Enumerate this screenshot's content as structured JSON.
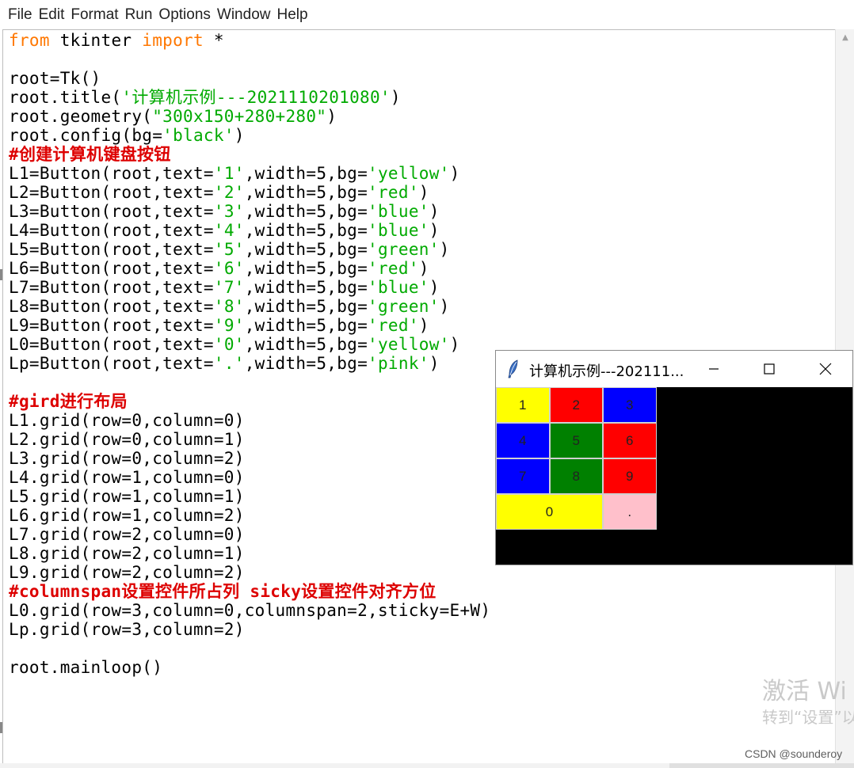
{
  "menu": [
    "File",
    "Edit",
    "Format",
    "Run",
    "Options",
    "Window",
    "Help"
  ],
  "code_lines": [
    [
      {
        "t": "from",
        "c": "kw"
      },
      {
        "t": " tkinter "
      },
      {
        "t": "import",
        "c": "kw"
      },
      {
        "t": " *"
      }
    ],
    [],
    [
      {
        "t": "root=Tk()"
      }
    ],
    [
      {
        "t": "root.title("
      },
      {
        "t": "'计算机示例---2021110201080'",
        "c": "str"
      },
      {
        "t": ")"
      }
    ],
    [
      {
        "t": "root.geometry("
      },
      {
        "t": "\"300x150+280+280\"",
        "c": "str"
      },
      {
        "t": ")"
      }
    ],
    [
      {
        "t": "root.config(bg="
      },
      {
        "t": "'black'",
        "c": "str"
      },
      {
        "t": ")"
      }
    ],
    [
      {
        "t": "#创建计算机键盘按钮",
        "c": "cmt"
      }
    ],
    [
      {
        "t": "L1=Button(root,text="
      },
      {
        "t": "'1'",
        "c": "str"
      },
      {
        "t": ",width=5,bg="
      },
      {
        "t": "'yellow'",
        "c": "str"
      },
      {
        "t": ")"
      }
    ],
    [
      {
        "t": "L2=Button(root,text="
      },
      {
        "t": "'2'",
        "c": "str"
      },
      {
        "t": ",width=5,bg="
      },
      {
        "t": "'red'",
        "c": "str"
      },
      {
        "t": ")"
      }
    ],
    [
      {
        "t": "L3=Button(root,text="
      },
      {
        "t": "'3'",
        "c": "str"
      },
      {
        "t": ",width=5,bg="
      },
      {
        "t": "'blue'",
        "c": "str"
      },
      {
        "t": ")"
      }
    ],
    [
      {
        "t": "L4=Button(root,text="
      },
      {
        "t": "'4'",
        "c": "str"
      },
      {
        "t": ",width=5,bg="
      },
      {
        "t": "'blue'",
        "c": "str"
      },
      {
        "t": ")"
      }
    ],
    [
      {
        "t": "L5=Button(root,text="
      },
      {
        "t": "'5'",
        "c": "str"
      },
      {
        "t": ",width=5,bg="
      },
      {
        "t": "'green'",
        "c": "str"
      },
      {
        "t": ")"
      }
    ],
    [
      {
        "t": "L6=Button(root,text="
      },
      {
        "t": "'6'",
        "c": "str"
      },
      {
        "t": ",width=5,bg="
      },
      {
        "t": "'red'",
        "c": "str"
      },
      {
        "t": ")"
      }
    ],
    [
      {
        "t": "L7=Button(root,text="
      },
      {
        "t": "'7'",
        "c": "str"
      },
      {
        "t": ",width=5,bg="
      },
      {
        "t": "'blue'",
        "c": "str"
      },
      {
        "t": ")"
      }
    ],
    [
      {
        "t": "L8=Button(root,text="
      },
      {
        "t": "'8'",
        "c": "str"
      },
      {
        "t": ",width=5,bg="
      },
      {
        "t": "'green'",
        "c": "str"
      },
      {
        "t": ")"
      }
    ],
    [
      {
        "t": "L9=Button(root,text="
      },
      {
        "t": "'9'",
        "c": "str"
      },
      {
        "t": ",width=5,bg="
      },
      {
        "t": "'red'",
        "c": "str"
      },
      {
        "t": ")"
      }
    ],
    [
      {
        "t": "L0=Button(root,text="
      },
      {
        "t": "'0'",
        "c": "str"
      },
      {
        "t": ",width=5,bg="
      },
      {
        "t": "'yellow'",
        "c": "str"
      },
      {
        "t": ")"
      }
    ],
    [
      {
        "t": "Lp=Button(root,text="
      },
      {
        "t": "'.'",
        "c": "str"
      },
      {
        "t": ",width=5,bg="
      },
      {
        "t": "'pink'",
        "c": "str"
      },
      {
        "t": ")"
      }
    ],
    [],
    [
      {
        "t": "#gird进行布局",
        "c": "cmt"
      }
    ],
    [
      {
        "t": "L1.grid(row=0,column=0)"
      }
    ],
    [
      {
        "t": "L2.grid(row=0,column=1)"
      }
    ],
    [
      {
        "t": "L3.grid(row=0,column=2)"
      }
    ],
    [
      {
        "t": "L4.grid(row=1,column=0)"
      }
    ],
    [
      {
        "t": "L5.grid(row=1,column=1)"
      }
    ],
    [
      {
        "t": "L6.grid(row=1,column=2)"
      }
    ],
    [
      {
        "t": "L7.grid(row=2,column=0)"
      }
    ],
    [
      {
        "t": "L8.grid(row=2,column=1)"
      }
    ],
    [
      {
        "t": "L9.grid(row=2,column=2)"
      }
    ],
    [
      {
        "t": "#columnspan设置控件所占列 sicky设置控件对齐方位",
        "c": "cmt"
      }
    ],
    [
      {
        "t": "L0.grid(row=3,column=0,columnspan=2,sticky=E+W)"
      }
    ],
    [
      {
        "t": "Lp.grid(row=3,column=2)"
      }
    ],
    [],
    [
      {
        "t": "root.mainloop()"
      }
    ]
  ],
  "tk_window": {
    "title": "计算机示例---202111...",
    "minimize_icon": "minimize-icon",
    "maximize_icon": "maximize-icon",
    "close_icon": "close-icon",
    "background": "#000000",
    "buttons": [
      {
        "label": "1",
        "color": "#ffff00",
        "row": 0,
        "col": 0,
        "span": 1
      },
      {
        "label": "2",
        "color": "#ff0000",
        "row": 0,
        "col": 1,
        "span": 1
      },
      {
        "label": "3",
        "color": "#0000ff",
        "row": 0,
        "col": 2,
        "span": 1
      },
      {
        "label": "4",
        "color": "#0000ff",
        "row": 1,
        "col": 0,
        "span": 1
      },
      {
        "label": "5",
        "color": "#008000",
        "row": 1,
        "col": 1,
        "span": 1
      },
      {
        "label": "6",
        "color": "#ff0000",
        "row": 1,
        "col": 2,
        "span": 1
      },
      {
        "label": "7",
        "color": "#0000ff",
        "row": 2,
        "col": 0,
        "span": 1
      },
      {
        "label": "8",
        "color": "#008000",
        "row": 2,
        "col": 1,
        "span": 1
      },
      {
        "label": "9",
        "color": "#ff0000",
        "row": 2,
        "col": 2,
        "span": 1
      },
      {
        "label": "0",
        "color": "#ffff00",
        "row": 3,
        "col": 0,
        "span": 2
      },
      {
        "label": ".",
        "color": "#ffc0cb",
        "row": 3,
        "col": 2,
        "span": 1
      }
    ]
  },
  "watermark": {
    "line1": "激活 Wi",
    "line2": "转到“设置”以"
  },
  "credit": "CSDN @sounderoy",
  "colors": {
    "keyword": "#ff7700",
    "string": "#00aa00",
    "comment": "#dd0000"
  }
}
